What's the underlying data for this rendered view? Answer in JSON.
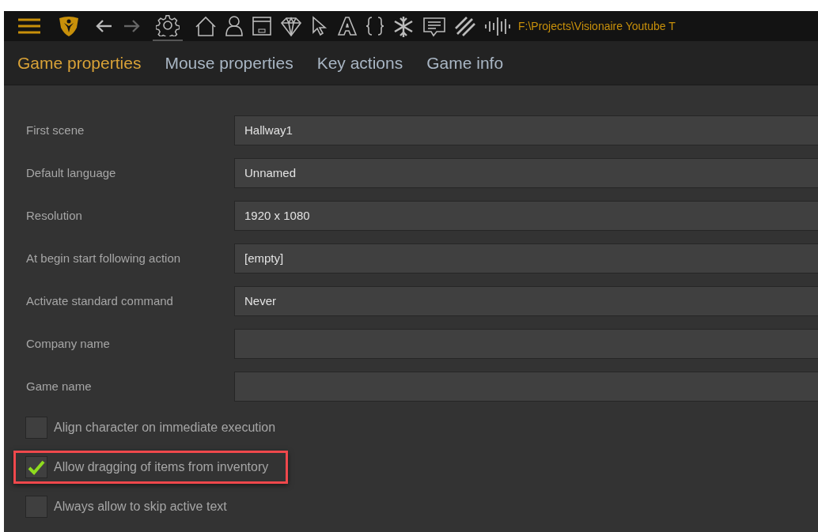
{
  "toolbar": {
    "tools": [
      {
        "kind": "menu",
        "selected": false
      },
      {
        "kind": "logo",
        "selected": false
      },
      {
        "kind": "back",
        "selected": false,
        "disabled": false
      },
      {
        "kind": "forward",
        "selected": false,
        "disabled": true
      },
      {
        "kind": "gear",
        "selected": true
      },
      {
        "kind": "home",
        "selected": false
      },
      {
        "kind": "user",
        "selected": false
      },
      {
        "kind": "dialog",
        "selected": false
      },
      {
        "kind": "diamond",
        "selected": false
      },
      {
        "kind": "cursor",
        "selected": false
      },
      {
        "kind": "font",
        "selected": false
      },
      {
        "kind": "braces",
        "selected": false
      },
      {
        "kind": "snowflake",
        "selected": false
      },
      {
        "kind": "comment",
        "selected": false
      },
      {
        "kind": "stripes",
        "selected": false
      },
      {
        "kind": "waveform",
        "selected": false
      }
    ],
    "path": "F:\\Projects\\Visionaire Youtube T"
  },
  "tabs": [
    {
      "label": "Game properties",
      "selected": true
    },
    {
      "label": "Mouse properties",
      "selected": false
    },
    {
      "label": "Key actions",
      "selected": false
    },
    {
      "label": "Game info",
      "selected": false
    }
  ],
  "fields": [
    {
      "label": "First scene",
      "value": "Hallway1"
    },
    {
      "label": "Default language",
      "value": "Unnamed"
    },
    {
      "label": "Resolution",
      "value": "1920 x 1080"
    },
    {
      "label": "At begin start following action",
      "value": "[empty]"
    },
    {
      "label": "Activate standard command",
      "value": "Never"
    },
    {
      "label": "Company name"
    },
    {
      "label": "Game name"
    }
  ],
  "checkboxes": [
    {
      "label": "Align character on immediate execution",
      "checked": false,
      "highlighted": false
    },
    {
      "label": "Allow dragging of items from inventory",
      "checked": true,
      "highlighted": true
    },
    {
      "label": "Always allow to skip active text",
      "checked": false,
      "highlighted": false
    }
  ]
}
